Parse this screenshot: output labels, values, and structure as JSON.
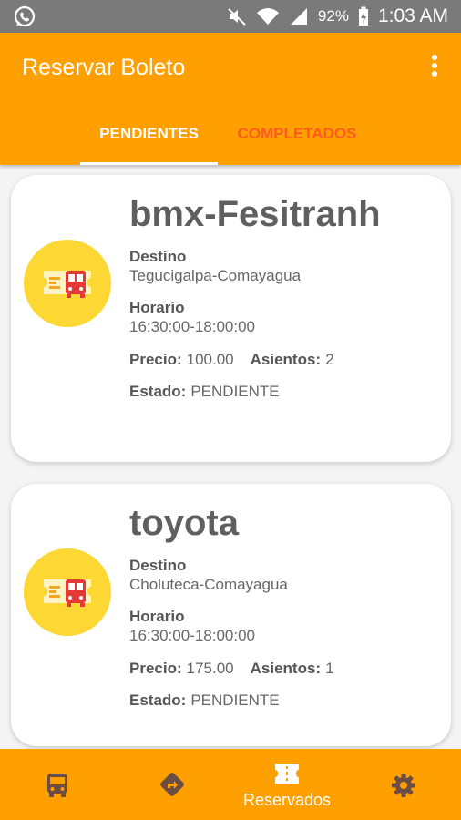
{
  "statusbar": {
    "left_icon": "whatsapp-icon",
    "battery": "92%",
    "time": "1:03 AM"
  },
  "appbar": {
    "title": "Reservar Boleto",
    "menu_icon": "more-vert-icon"
  },
  "tabs": [
    {
      "label": "PENDIENTES",
      "active": true
    },
    {
      "label": "COMPLETADOS",
      "active": false
    }
  ],
  "labels": {
    "destino": "Destino",
    "horario": "Horario",
    "precio": "Precio:",
    "asientos": "Asientos:",
    "estado": "Estado:"
  },
  "tickets": [
    {
      "name": "bmx-Fesitranh",
      "destino": "Tegucigalpa-Comayagua",
      "horario": "16:30:00-18:00:00",
      "precio": "100.00",
      "asientos": "2",
      "estado": "PENDIENTE",
      "icon": "bus-ticket-icon"
    },
    {
      "name": "toyota",
      "destino": "Choluteca-Comayagua",
      "horario": "16:30:00-18:00:00",
      "precio": "175.00",
      "asientos": "1",
      "estado": "PENDIENTE",
      "icon": "bus-ticket-icon"
    }
  ],
  "bottom_nav": [
    {
      "icon": "bus-icon",
      "label": ""
    },
    {
      "icon": "directions-icon",
      "label": ""
    },
    {
      "icon": "ticket-icon",
      "label": "Reservados",
      "active": true
    },
    {
      "icon": "settings-icon",
      "label": ""
    }
  ],
  "colors": {
    "primary": "#ffa000",
    "inactive_tab": "#ff5a1f",
    "avatar": "#fdd835",
    "status_bar": "#7a7a7a"
  }
}
